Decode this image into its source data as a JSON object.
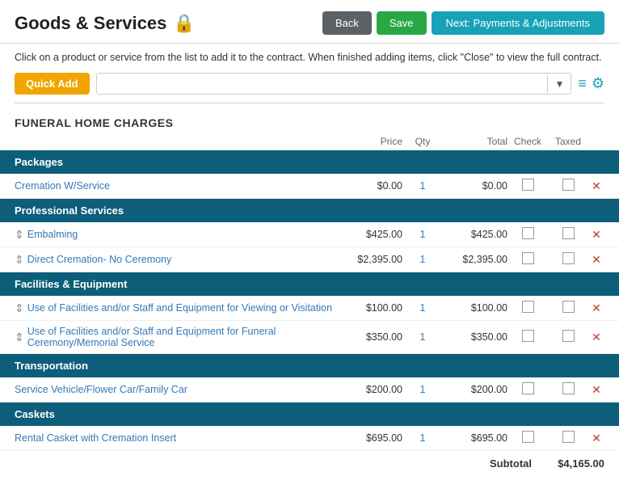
{
  "header": {
    "title": "Goods & Services",
    "lock_icon": "🔒",
    "back_label": "Back",
    "save_label": "Save",
    "next_label": "Next: Payments & Adjustments"
  },
  "info": {
    "message": "Click on a product or service from the list to add it to the contract. When finished adding items, click \"Close\" to view the full contract."
  },
  "toolbar": {
    "quick_add_label": "Quick Add",
    "search_placeholder": "",
    "search_value": ""
  },
  "section": {
    "title": "FUNERAL HOME CHARGES",
    "columns": {
      "price": "Price",
      "qty": "Qty",
      "total": "Total",
      "check": "Check",
      "taxed": "Taxed"
    }
  },
  "categories": [
    {
      "name": "Packages",
      "items": [
        {
          "name": "Cremation W/Service",
          "price": "$0.00",
          "qty": "1",
          "total": "$0.00",
          "sortable": false
        }
      ]
    },
    {
      "name": "Professional Services",
      "items": [
        {
          "name": "Embalming",
          "price": "$425.00",
          "qty": "1",
          "total": "$425.00",
          "sortable": true
        },
        {
          "name": "Direct Cremation- No Ceremony",
          "price": "$2,395.00",
          "qty": "1",
          "total": "$2,395.00",
          "sortable": true
        }
      ]
    },
    {
      "name": "Facilities & Equipment",
      "items": [
        {
          "name": "Use of Facilities and/or Staff and Equipment for Viewing or Visitation",
          "price": "$100.00",
          "qty": "1",
          "total": "$100.00",
          "sortable": true
        },
        {
          "name": "Use of Facilities and/or Staff and Equipment for Funeral Ceremony/Memorial Service",
          "price": "$350.00",
          "qty": "1",
          "total": "$350.00",
          "sortable": true
        }
      ]
    },
    {
      "name": "Transportation",
      "items": [
        {
          "name": "Service Vehicle/Flower Car/Family Car",
          "price": "$200.00",
          "qty": "1",
          "total": "$200.00",
          "sortable": false
        }
      ]
    },
    {
      "name": "Caskets",
      "items": [
        {
          "name": "Rental Casket with Cremation Insert",
          "price": "$695.00",
          "qty": "1",
          "total": "$695.00",
          "sortable": false
        }
      ]
    }
  ],
  "subtotal": {
    "label": "Subtotal",
    "value": "$4,165.00"
  }
}
